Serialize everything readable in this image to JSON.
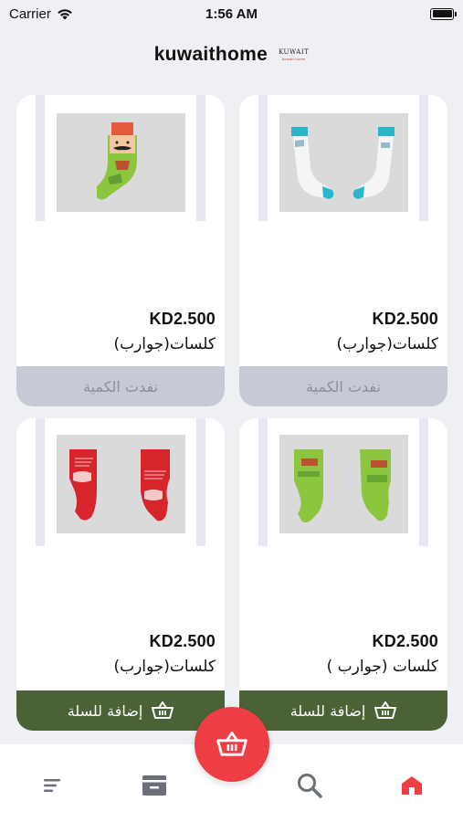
{
  "status_bar": {
    "carrier": "Carrier",
    "time": "1:56 AM"
  },
  "header": {
    "title": "kuwaithome",
    "logo_text": "KUWAIT",
    "logo_subtext": "kuwait home"
  },
  "products": [
    {
      "price": "KD2.500",
      "name": "كلسات(جوارب)",
      "button": "نفدت الكمية",
      "status": "sold_out",
      "image": "white-teal-socks"
    },
    {
      "price": "KD2.500",
      "name": "كلسات(جوارب)",
      "button": "نفدت الكمية",
      "status": "sold_out",
      "image": "green-face-socks"
    },
    {
      "price": "KD2.500",
      "name": "كلسات (جوارب )",
      "button": "إضافة للسلة",
      "status": "available",
      "image": "green-print-socks"
    },
    {
      "price": "KD2.500",
      "name": "كلسات(جوارب)",
      "button": "إضافة للسلة",
      "status": "available",
      "image": "red-print-socks"
    }
  ],
  "nav": {
    "items": [
      "home-icon",
      "search-icon",
      "cart-icon",
      "menu-icon"
    ],
    "active": "home-icon"
  },
  "colors": {
    "accent": "#ee3d44",
    "add_button": "#4a6236",
    "sold_out_button": "#c5cad6",
    "background": "#eef0f4"
  }
}
